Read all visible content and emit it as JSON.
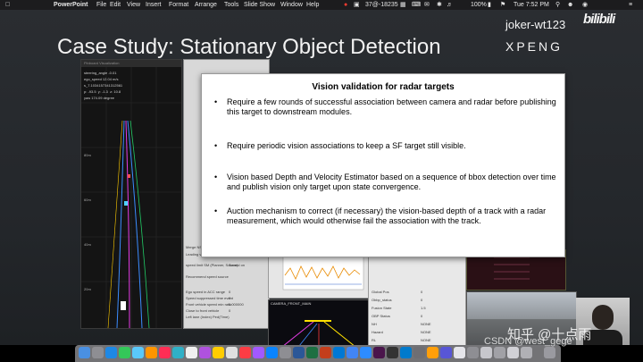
{
  "menubar": {
    "app_name": "PowerPoint",
    "menus": [
      "File",
      "Edit",
      "View",
      "Insert",
      "Format",
      "Arrange",
      "Tools",
      "Slide Show",
      "Window",
      "Help"
    ],
    "status": "37@-18235",
    "battery": "100%",
    "clock": "Tue 7:52 PM"
  },
  "slide": {
    "title": "Case Study: Stationary Object Detection"
  },
  "overlay": {
    "uploader": "joker-wt123",
    "bilibili": "bilibili",
    "brand": "XPENG"
  },
  "popup": {
    "title": "Vision validation for radar targets",
    "bullets": [
      "Require a few rounds of successful association between camera and radar before publishing this target to downstream modules.",
      "Require periodic vision associations to keep a SF target still visible.",
      "Vision based Depth and Velocity Estimator based on a sequence of bbox detection over time and publish vision only target upon state convergence.",
      "Auction mechanism to correct (if necessary) the vision-based depth of a track with a radar measurement, which would otherwise fail the association with the track."
    ]
  },
  "viz": {
    "header": "Pinboard Visualization",
    "distance_labels": [
      "80m",
      "60m",
      "40m",
      "20m"
    ]
  },
  "midpanel": {
    "rows": [
      {
        "label": "Merge NS LFB",
        "value": "0"
      },
      {
        "label": "Leading vehicle ID, dist, accel",
        "value": "No leading vehicle"
      },
      {
        "label": "speed limit SM (Planner, Source)",
        "value": "Turned on"
      },
      {
        "label": "Recommend speed source",
        "value": ""
      },
      {
        "label": "Ego speed in ACC range",
        "value": "0"
      },
      {
        "label": "Speed suppressed time event",
        "value": "0"
      },
      {
        "label": "Front vehicle speed min ratio",
        "value": "0.000000"
      },
      {
        "label": "Close to front vehicle",
        "value": "0"
      },
      {
        "label": "Left lane (Index) Ped(Time)",
        "value": ""
      }
    ]
  },
  "camview": {
    "label": "CAMERA_FRONT_MAIN"
  },
  "tablepanel": {
    "rows": [
      {
        "label": "Global Pos",
        "value": "0"
      },
      {
        "label": "Obbp_status",
        "value": "0"
      },
      {
        "label": "Fusion State",
        "value": "1.5"
      },
      {
        "label": "OBP Status",
        "value": "0"
      },
      {
        "label": "NH",
        "value": "NONE"
      },
      {
        "label": "Hazard",
        "value": "NONE"
      },
      {
        "label": "RL",
        "value": "NONE"
      }
    ]
  },
  "watermark": {
    "zhihu": "知乎 @十点雨",
    "csdn": "CSDN @west_gege"
  },
  "colors": {
    "slide_bg": "#26292d",
    "popup_bg": "#ffffff",
    "dock_bg": "#cfcfd4"
  }
}
